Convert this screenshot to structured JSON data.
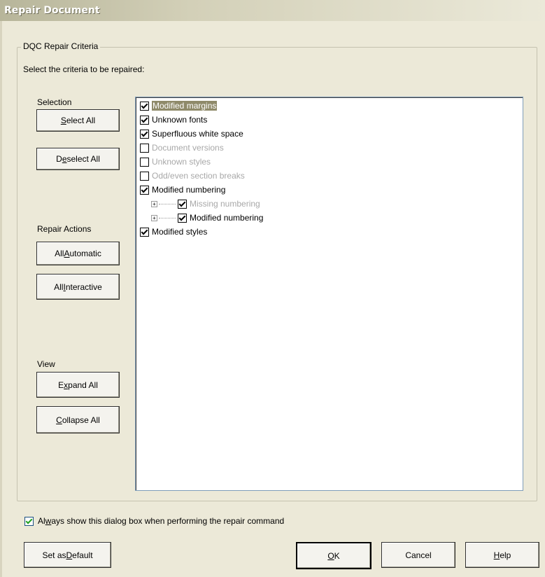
{
  "window": {
    "title": "Repair Document"
  },
  "group": {
    "legend": "DQC Repair Criteria",
    "instruction": "Select the criteria to be repaired:"
  },
  "selection": {
    "label": "Selection",
    "select_all_pre": "",
    "select_all_u": "S",
    "select_all_post": "elect All",
    "deselect_all_pre": "D",
    "deselect_all_u": "e",
    "deselect_all_post": "select All"
  },
  "repair_actions": {
    "label": "Repair Actions",
    "automatic_pre": "All ",
    "automatic_u": "A",
    "automatic_post": "utomatic",
    "interactive_pre": "All ",
    "interactive_u": "I",
    "interactive_post": "nteractive"
  },
  "view": {
    "label": "View",
    "expand_pre": "E",
    "expand_u": "x",
    "expand_post": "pand All",
    "collapse_pre": "",
    "collapse_u": "C",
    "collapse_post": "ollapse All"
  },
  "criteria": [
    {
      "label": "Modified margins",
      "checked": true,
      "enabled": true,
      "selected": true
    },
    {
      "label": "Unknown fonts",
      "checked": true,
      "enabled": true
    },
    {
      "label": "Superfluous white space",
      "checked": true,
      "enabled": true
    },
    {
      "label": "Document versions",
      "checked": false,
      "enabled": false
    },
    {
      "label": "Unknown styles",
      "checked": false,
      "enabled": false
    },
    {
      "label": "Odd/even section breaks",
      "checked": false,
      "enabled": false
    },
    {
      "label": "Modified numbering",
      "checked": true,
      "enabled": true
    },
    {
      "label": "Missing numbering",
      "checked": true,
      "enabled": false,
      "child": true
    },
    {
      "label": "Modified numbering",
      "checked": true,
      "enabled": true,
      "child": true
    },
    {
      "label": "Modified styles",
      "checked": true,
      "enabled": true
    }
  ],
  "always_show": {
    "checked": true,
    "pre": "Al",
    "u": "w",
    "post": "ays show this dialog box when performing the repair command"
  },
  "footer": {
    "set_default_pre": "Set as ",
    "set_default_u": "D",
    "set_default_post": "efault",
    "ok_pre": "",
    "ok_u": "O",
    "ok_post": "K",
    "cancel": "Cancel",
    "help_pre": "",
    "help_u": "H",
    "help_post": "elp"
  }
}
